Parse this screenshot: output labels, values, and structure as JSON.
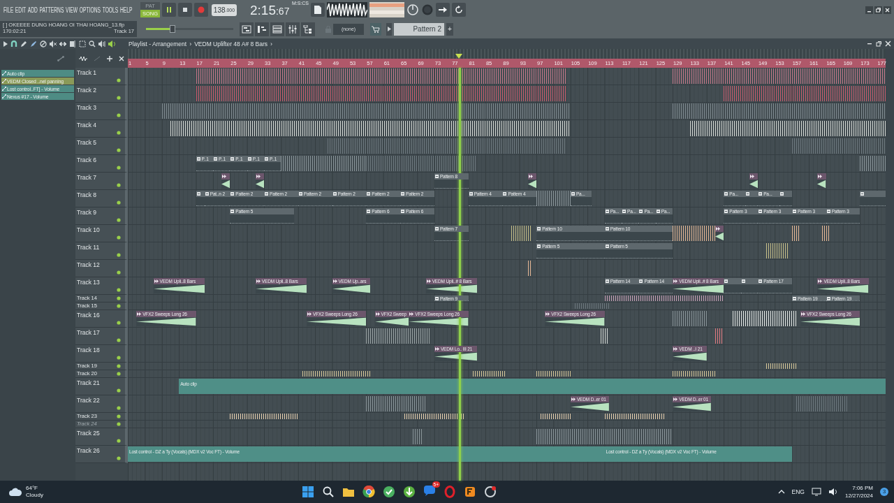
{
  "menu": [
    "FILE",
    "EDIT",
    "ADD",
    "PATTERNS",
    "VIEW",
    "OPTIONS",
    "TOOLS",
    "HELP"
  ],
  "transport": {
    "modes": [
      {
        "label": "PAT",
        "selected": false
      },
      {
        "label": "SONG",
        "selected": true
      }
    ],
    "playing": true,
    "tempo": "138",
    "tempo_decimals": ".000",
    "time": "2:15",
    "time_cs": ":67",
    "time_format": "M:S:CS"
  },
  "hint": {
    "file": "[   ] OKEEEE DUNG HOANG OI THAI HOANG_13.flp",
    "position": "170:02:21",
    "track": "Track 17"
  },
  "master": {
    "level": 0.3
  },
  "pattern_selector": {
    "channel": "(none)",
    "pattern": "Pattern 2",
    "add": "+"
  },
  "playlist": {
    "title": "Playlist - Arrangement",
    "separator": "›",
    "crumb": "VEDM Uplifter 48 A# 8 Bars",
    "crumb_end": "›"
  },
  "browser": [
    {
      "label": "Auto clip",
      "selected": false
    },
    {
      "label": "VEDM Closed ..nel panning",
      "selected": true
    },
    {
      "label": "Lost control..FT] - Volume",
      "selected": false
    },
    {
      "label": "Nexus #17 - Volume",
      "selected": false
    }
  ],
  "ruler": [
    "1",
    "5",
    "9",
    "13",
    "17",
    "21",
    "25",
    "29",
    "33",
    "37",
    "41",
    "45",
    "49",
    "53",
    "57",
    "61",
    "65",
    "69",
    "73",
    "77",
    "81",
    "85",
    "89",
    "93",
    "97",
    "101",
    "105",
    "109",
    "113",
    "117",
    "121",
    "125",
    "129",
    "133",
    "137",
    "141",
    "145",
    "149",
    "153",
    "157",
    "161",
    "165",
    "169",
    "173",
    "177"
  ],
  "playhead": {
    "level": 0.437
  },
  "tracks": [
    {
      "name": "Track 1",
      "kind": "full",
      "disabled": false,
      "clips": [
        {
          "kind": "block",
          "color": "#c4788a"
        },
        {
          "kind": "block",
          "color": "#c4788a"
        }
      ]
    },
    {
      "name": "Track 2",
      "kind": "full",
      "disabled": false,
      "clips": [
        {
          "kind": "block",
          "color": "#c85c6e"
        },
        {
          "kind": "block",
          "color": "#c85c6e"
        }
      ]
    },
    {
      "name": "Track 3",
      "kind": "full",
      "disabled": false,
      "clips": [
        {
          "kind": "block",
          "color": "#7f8a90"
        },
        {
          "kind": "block",
          "color": "#7f8a90"
        }
      ]
    },
    {
      "name": "Track 4",
      "kind": "full",
      "disabled": false,
      "clips": [
        {
          "kind": "block",
          "color": "#d6dad6"
        },
        {
          "kind": "block",
          "color": "#d6dad6"
        }
      ]
    },
    {
      "name": "Track 5",
      "kind": "full",
      "disabled": false,
      "clips": [
        {
          "kind": "block",
          "color": "#6d787e"
        },
        {
          "kind": "block",
          "color": "#6d787e"
        }
      ]
    },
    {
      "name": "Track 6",
      "kind": "full",
      "disabled": false,
      "clips": [
        {
          "kind": "pattern",
          "label": "P..1"
        },
        {
          "kind": "pattern",
          "label": "P..1"
        },
        {
          "kind": "pattern",
          "label": "P..1"
        },
        {
          "kind": "pattern",
          "label": "P..1"
        },
        {
          "kind": "pattern",
          "label": "P..1"
        },
        {
          "kind": "block",
          "color": "#8a959a"
        },
        {
          "kind": "block",
          "color": "#6d787e"
        },
        {
          "kind": "block",
          "color": "#8a959a"
        }
      ]
    },
    {
      "name": "Track 7",
      "kind": "full",
      "disabled": false,
      "clips": [
        {
          "kind": "audio"
        },
        {
          "kind": "audio"
        },
        {
          "kind": "pattern",
          "label": "Pattern 8"
        },
        {
          "kind": "audio"
        },
        {
          "kind": "audio"
        },
        {
          "kind": "audio"
        }
      ]
    },
    {
      "name": "Track 8",
      "kind": "full",
      "disabled": false,
      "clips": [
        {
          "kind": "pattern"
        },
        {
          "kind": "pattern",
          "label": "Pat..n 2"
        },
        {
          "kind": "pattern",
          "label": "Pattern 2"
        },
        {
          "kind": "pattern",
          "label": "Pattern 2"
        },
        {
          "kind": "pattern",
          "label": "Pattern 2"
        },
        {
          "kind": "pattern",
          "label": "Pattern 2"
        },
        {
          "kind": "pattern",
          "label": "Pattern 2"
        },
        {
          "kind": "pattern",
          "label": "Pattern 2"
        },
        {
          "kind": "pattern",
          "label": "Pattern 4"
        },
        {
          "kind": "pattern",
          "label": "Pattern 4"
        },
        {
          "kind": "block",
          "color": "#8a959a"
        },
        {
          "kind": "pattern",
          "label": "Pa..."
        },
        {
          "kind": "pattern",
          "label": "Pa..."
        },
        {
          "kind": "pattern"
        },
        {
          "kind": "pattern",
          "label": "Pa..."
        },
        {
          "kind": "pattern"
        },
        {
          "kind": "pattern"
        }
      ]
    },
    {
      "name": "Track 9",
      "kind": "full",
      "disabled": false,
      "clips": [
        {
          "kind": "pattern",
          "label": "Pattern 5"
        },
        {
          "kind": "pattern",
          "label": "Pattern 6"
        },
        {
          "kind": "pattern",
          "label": "Pattern 6"
        },
        {
          "kind": "pattern",
          "label": "Pa..."
        },
        {
          "kind": "pattern",
          "label": "Pa..."
        },
        {
          "kind": "pattern",
          "label": "Pa..."
        },
        {
          "kind": "pattern",
          "label": "Pa..."
        },
        {
          "kind": "pattern",
          "label": "Pattern 3"
        },
        {
          "kind": "pattern",
          "label": "Pattern 3"
        },
        {
          "kind": "pattern",
          "label": "Pattern 3"
        },
        {
          "kind": "pattern",
          "label": "Pattern 3"
        }
      ]
    },
    {
      "name": "Track 10",
      "kind": "full",
      "disabled": false,
      "clips": [
        {
          "kind": "pattern",
          "label": "Pattern 7"
        },
        {
          "kind": "block",
          "color": "#c8c08a"
        },
        {
          "kind": "pattern",
          "label": "Pattern 10"
        },
        {
          "kind": "pattern",
          "label": "Pattern 10"
        },
        {
          "kind": "block",
          "color": "#e6b896"
        },
        {
          "kind": "audio"
        },
        {
          "kind": "block",
          "color": "#e6b896"
        },
        {
          "kind": "block",
          "color": "#e6b896"
        }
      ]
    },
    {
      "name": "Track 11",
      "kind": "full",
      "disabled": false,
      "clips": [
        {
          "kind": "pattern",
          "label": "Pattern 5"
        },
        {
          "kind": "pattern",
          "label": "Pattern 5"
        },
        {
          "kind": "block",
          "color": "#c8c08a"
        }
      ]
    },
    {
      "name": "Track 12",
      "kind": "full",
      "disabled": false,
      "clips": [
        {
          "kind": "block",
          "color": "#e6b896"
        }
      ]
    },
    {
      "name": "Track 13",
      "kind": "full",
      "disabled": false,
      "clips": [
        {
          "kind": "audio",
          "label": "VEDM Upli..8 Bars"
        },
        {
          "kind": "audio",
          "label": "VEDM Upli..8 Bars"
        },
        {
          "kind": "audio",
          "label": "VEDM Up..ars"
        },
        {
          "kind": "audio",
          "label": "VEDM Upli..# 8 Bars"
        },
        {
          "kind": "pattern",
          "label": "Pattern 14"
        },
        {
          "kind": "pattern",
          "label": "Pattern 14"
        },
        {
          "kind": "audio",
          "label": "VEDM Upli..# 8 Bars"
        },
        {
          "kind": "pattern"
        },
        {
          "kind": "pattern"
        },
        {
          "kind": "pattern",
          "label": "Pattern 17"
        },
        {
          "kind": "audio",
          "label": "VEDM Upli..8 Bars"
        }
      ]
    },
    {
      "name": "Track 14",
      "kind": "thin",
      "disabled": false,
      "clips": [
        {
          "kind": "pattern",
          "label": "Pattern 9"
        },
        {
          "kind": "block",
          "color": "#c9a0b8"
        },
        {
          "kind": "pattern",
          "label": "Pattern 19"
        },
        {
          "kind": "pattern",
          "label": "Pattern 19"
        }
      ]
    },
    {
      "name": "Track 15",
      "kind": "thin",
      "disabled": false,
      "clips": [
        {
          "kind": "block",
          "color": "#6d787e"
        }
      ]
    },
    {
      "name": "Track 16",
      "kind": "full",
      "disabled": false,
      "clips": [
        {
          "kind": "audio",
          "label": "VFX2 Sweeps Long 26"
        },
        {
          "kind": "audio",
          "label": "VFX2 Sweeps Long 26"
        },
        {
          "kind": "audio",
          "label": "VFX2 Sweep"
        },
        {
          "kind": "audio",
          "label": "VFX2 Sweeps Long 26"
        },
        {
          "kind": "audio",
          "label": "VFX2 Sweeps Long 26"
        },
        {
          "kind": "block",
          "color": "#8a959a"
        },
        {
          "kind": "block",
          "color": "#e8ecea"
        },
        {
          "kind": "audio",
          "label": "VFX2 Sweeps Long 26"
        }
      ]
    },
    {
      "name": "Track 17",
      "kind": "full",
      "disabled": false,
      "clips": [
        {
          "kind": "block",
          "color": "#9aa3a5"
        },
        {
          "kind": "block",
          "color": "#d6dad6"
        },
        {
          "kind": "block",
          "color": "#e07a80"
        }
      ]
    },
    {
      "name": "Track 18",
      "kind": "full",
      "disabled": false,
      "clips": [
        {
          "kind": "audio",
          "label": "VEDM Lo.. III 21"
        },
        {
          "kind": "audio",
          "label": "VEDM ..I 21"
        }
      ]
    },
    {
      "name": "Track 19",
      "kind": "thin",
      "disabled": false,
      "clips": [
        {
          "kind": "block",
          "color": "#d8c89a"
        }
      ]
    },
    {
      "name": "Track 20",
      "kind": "thin",
      "disabled": false,
      "clips": [
        {
          "kind": "block",
          "color": "#d8c89a"
        },
        {
          "kind": "block",
          "color": "#d8c89a"
        },
        {
          "kind": "block",
          "color": "#d8c89a"
        },
        {
          "kind": "block",
          "color": "#d8c89a"
        }
      ]
    },
    {
      "name": "Track 21",
      "kind": "full",
      "disabled": false,
      "clips": [
        {
          "kind": "automation",
          "label": "Auto clip"
        }
      ]
    },
    {
      "name": "Track 22",
      "kind": "full",
      "disabled": false,
      "clips": [
        {
          "kind": "block",
          "color": "#8a959a"
        },
        {
          "kind": "audio",
          "label": "VEDM D..er 01"
        },
        {
          "kind": "audio",
          "label": "VEDM D..er 01"
        },
        {
          "kind": "block",
          "color": "#6d787e"
        }
      ]
    },
    {
      "name": "Track 23",
      "kind": "thin",
      "disabled": false,
      "clips": [
        {
          "kind": "block",
          "color": "#e8d0b0"
        },
        {
          "kind": "block",
          "color": "#e8d0b0"
        },
        {
          "kind": "block",
          "color": "#e8d0b0"
        },
        {
          "kind": "block",
          "color": "#e8d0b0"
        }
      ]
    },
    {
      "name": "Track 24",
      "kind": "thin",
      "disabled": true
    },
    {
      "name": "Track 25",
      "kind": "full",
      "disabled": false,
      "clips": [
        {
          "kind": "block",
          "color": "#8a959a"
        },
        {
          "kind": "block",
          "color": "#8a959a"
        }
      ]
    },
    {
      "name": "Track 26",
      "kind": "full",
      "disabled": false,
      "clips": [
        {
          "kind": "automation",
          "label": "Lost control - DZ a Ty (Vocals) (MDX v2 Voc FT) - Volume"
        },
        {
          "kind": "automation",
          "label": "Lost control - DZ a Ty (Vocals) (MDX v2 Voc FT) - Volume"
        }
      ]
    }
  ],
  "taskbar": {
    "temperature": "64°F",
    "weather": "Cloudy",
    "badge": "5+",
    "language": "ENG",
    "time": "7:06 PM",
    "date": "12/27/2024",
    "notifications": "3"
  }
}
